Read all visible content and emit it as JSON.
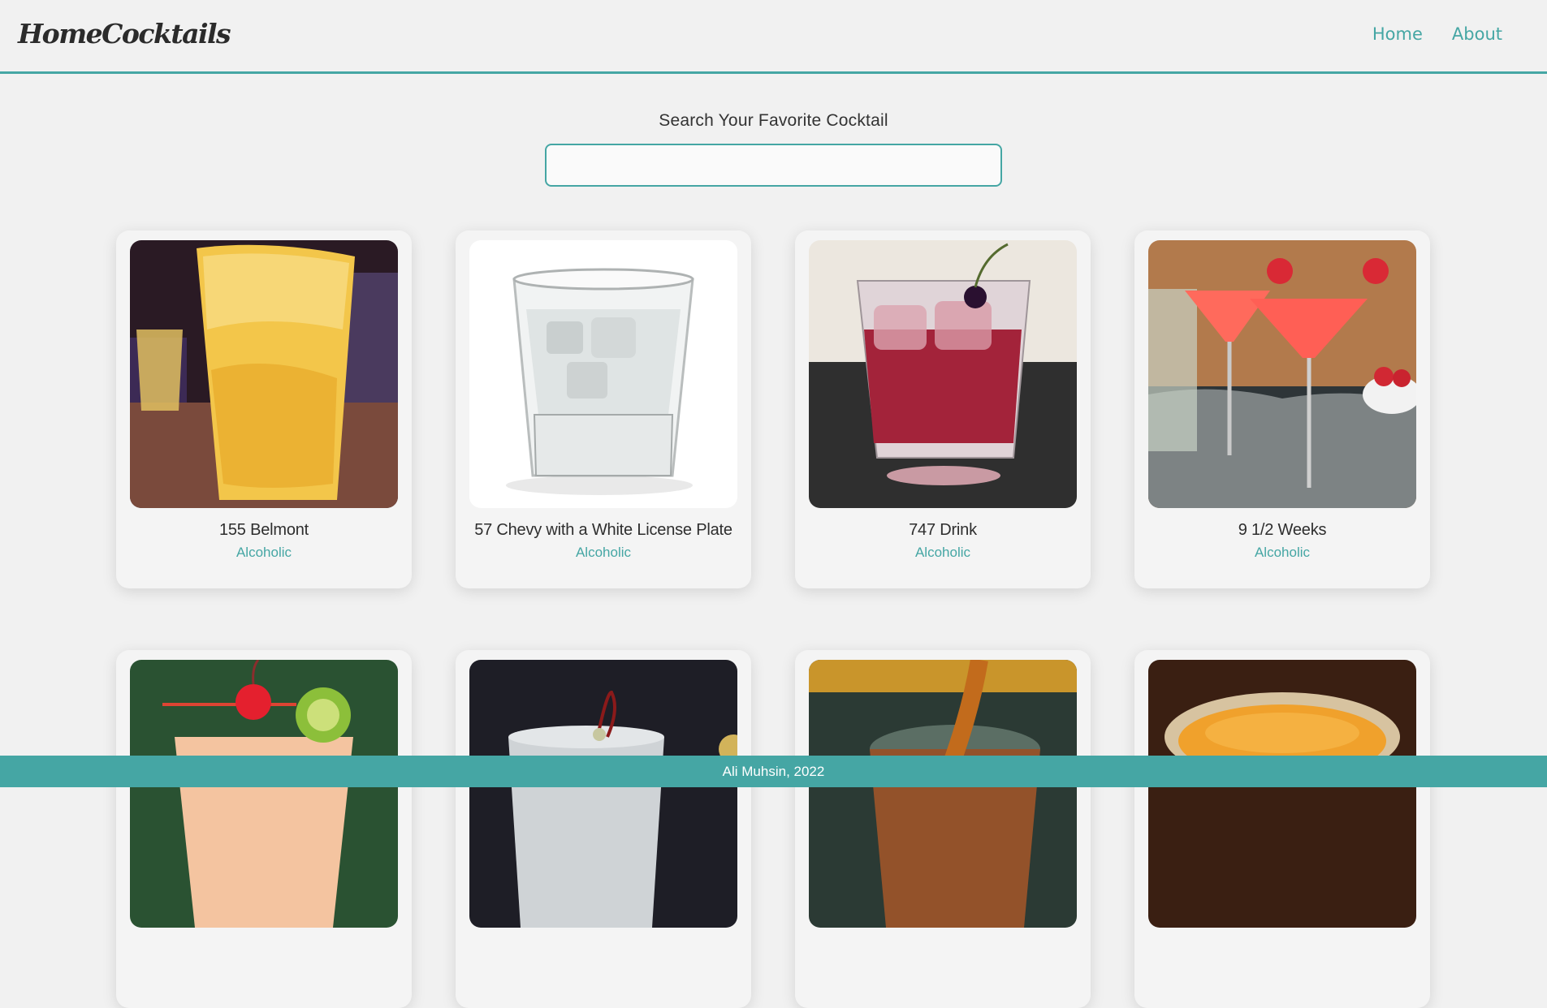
{
  "nav": {
    "logo": "HomeCocktails",
    "links": [
      "Home",
      "About"
    ]
  },
  "search": {
    "label": "Search Your Favorite Cocktail",
    "value": ""
  },
  "cocktails": [
    {
      "name": "155 Belmont",
      "type": "Alcoholic"
    },
    {
      "name": "57 Chevy with a White License Plate",
      "type": "Alcoholic"
    },
    {
      "name": "747 Drink",
      "type": "Alcoholic"
    },
    {
      "name": "9 1/2 Weeks",
      "type": "Alcoholic"
    },
    {
      "name": "",
      "type": ""
    },
    {
      "name": "",
      "type": ""
    },
    {
      "name": "",
      "type": ""
    },
    {
      "name": "",
      "type": ""
    }
  ],
  "footer": {
    "text": "Ali Muhsin, 2022"
  },
  "colors": {
    "accent": "#45a6a4",
    "background": "#f1f1f1",
    "text": "#333333"
  }
}
